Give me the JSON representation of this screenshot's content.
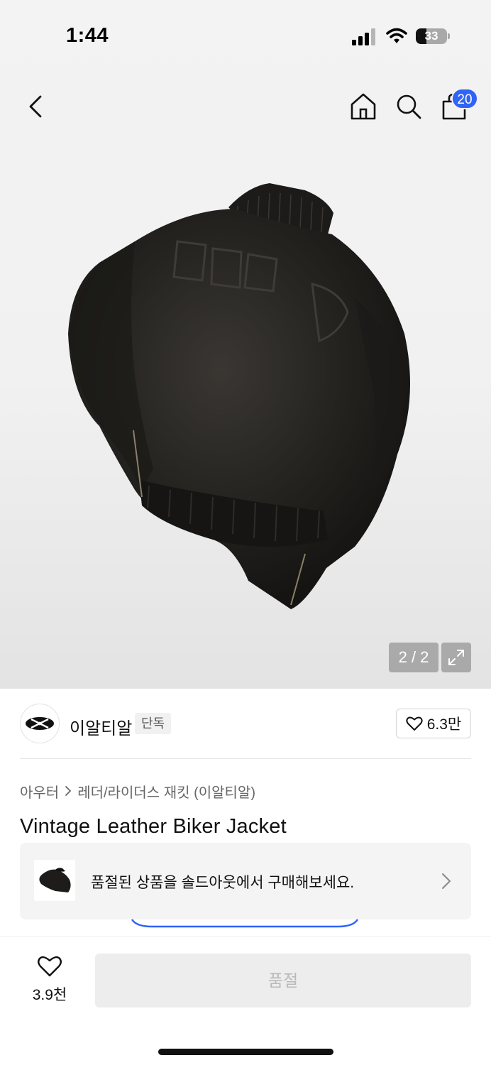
{
  "status_bar": {
    "time": "1:44",
    "battery_level": "33",
    "icons": [
      "signal-icon",
      "wifi-icon",
      "battery-icon"
    ]
  },
  "header": {
    "back_icon": "chevron-left-icon",
    "home_icon": "home-icon",
    "search_icon": "search-icon",
    "bag_icon": "shopping-bag-icon",
    "bag_count": "20"
  },
  "gallery": {
    "pager": "2 / 2",
    "expand_icon": "expand-arrows-icon"
  },
  "brand": {
    "name": "이알티알",
    "tag": "단독",
    "like_icon": "heart-outline-icon",
    "like_count": "6.3만"
  },
  "breadcrumb": {
    "category": "아우터",
    "separator_icon": "chevron-right-icon",
    "subcategory": "레더/라이더스 재킷 (이알티알)"
  },
  "product": {
    "title": "Vintage Leather Biker Jacket"
  },
  "soldout_banner": {
    "text": "품절된 상품을 솔드아웃에서 구매해보세요.",
    "chevron_icon": "chevron-right-icon"
  },
  "bottom_bar": {
    "wish_icon": "heart-outline-icon",
    "wish_count": "3.9천",
    "buy_label": "품절"
  },
  "colors": {
    "accent_blue": "#2f64f6",
    "disabled_bg": "#ededed",
    "disabled_text": "#b9b9b9"
  }
}
